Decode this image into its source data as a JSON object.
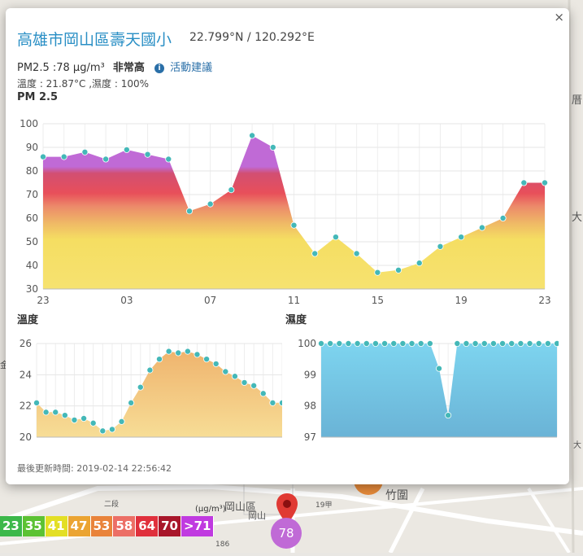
{
  "map": {
    "labels": [
      "岡山區",
      "岡山",
      "竹圍",
      "19甲",
      "186",
      "大",
      "大",
      "厝",
      "金",
      "二段"
    ]
  },
  "popup": {
    "close_label": "×",
    "title": "高雄市岡山區壽天國小",
    "coords": "22.799°N / 120.292°E",
    "pm_text": "PM2.5 :78 μg/m³",
    "level_text": "非常高",
    "info_icon": "i",
    "advice_text": "活動建議",
    "temp_humidity_text": "溫度 : 21.87°C ,濕度 : 100%",
    "pm_section_label": "PM 2.5",
    "temp_section_label": "溫度",
    "hum_section_label": "濕度",
    "updated_text": "最後更新時間: 2019-02-14 22:56:42"
  },
  "colors": {
    "title": "#2a8fc5",
    "point": "#44b8b8",
    "temp_fill": "#f2c27a",
    "hum_fill": "#6cc8e6",
    "marker": "#c06ad6"
  },
  "chart_data": [
    {
      "type": "area",
      "title": "PM 2.5",
      "x_ticks": [
        "23",
        "03",
        "07",
        "11",
        "15",
        "19",
        "23"
      ],
      "ylim": [
        30,
        100
      ],
      "y_ticks": [
        30,
        40,
        50,
        60,
        70,
        80,
        90,
        100
      ],
      "values": [
        86,
        86,
        88,
        85,
        89,
        87,
        85,
        63,
        66,
        72,
        95,
        90,
        57,
        45,
        52,
        45,
        37,
        38,
        41,
        48,
        52,
        56,
        60,
        75,
        75
      ],
      "grid": true
    },
    {
      "type": "area",
      "title": "溫度",
      "ylim": [
        20,
        26
      ],
      "y_ticks": [
        20,
        22,
        24,
        26
      ],
      "values": [
        22.2,
        21.6,
        21.6,
        21.4,
        21.1,
        21.2,
        20.9,
        20.4,
        20.5,
        21.0,
        22.2,
        23.2,
        24.3,
        25.0,
        25.5,
        25.4,
        25.5,
        25.3,
        25.0,
        24.7,
        24.2,
        23.9,
        23.5,
        23.3,
        22.8,
        22.2,
        22.2
      ],
      "grid": true
    },
    {
      "type": "area",
      "title": "濕度",
      "ylim": [
        97,
        100
      ],
      "y_ticks": [
        97,
        98,
        99,
        100
      ],
      "values": [
        100,
        100,
        100,
        100,
        100,
        100,
        100,
        100,
        100,
        100,
        100,
        100,
        100,
        99.2,
        97.7,
        100,
        100,
        100,
        100,
        100,
        100,
        100,
        100,
        100,
        100,
        100,
        100
      ],
      "grid": true
    }
  ],
  "legend": {
    "unit": "(μg/m³)",
    "items": [
      {
        "label": "23",
        "color": "#3cb84a"
      },
      {
        "label": "35",
        "color": "#5cc233"
      },
      {
        "label": "41",
        "color": "#e3df25"
      },
      {
        "label": "47",
        "color": "#eba432"
      },
      {
        "label": "53",
        "color": "#e9833a"
      },
      {
        "label": "58",
        "color": "#ec6f66"
      },
      {
        "label": "64",
        "color": "#e0303c"
      },
      {
        "label": "70",
        "color": "#a8162a"
      },
      {
        "label": ">71",
        "color": "#c03ae0"
      }
    ]
  },
  "marker": {
    "value": "78"
  }
}
